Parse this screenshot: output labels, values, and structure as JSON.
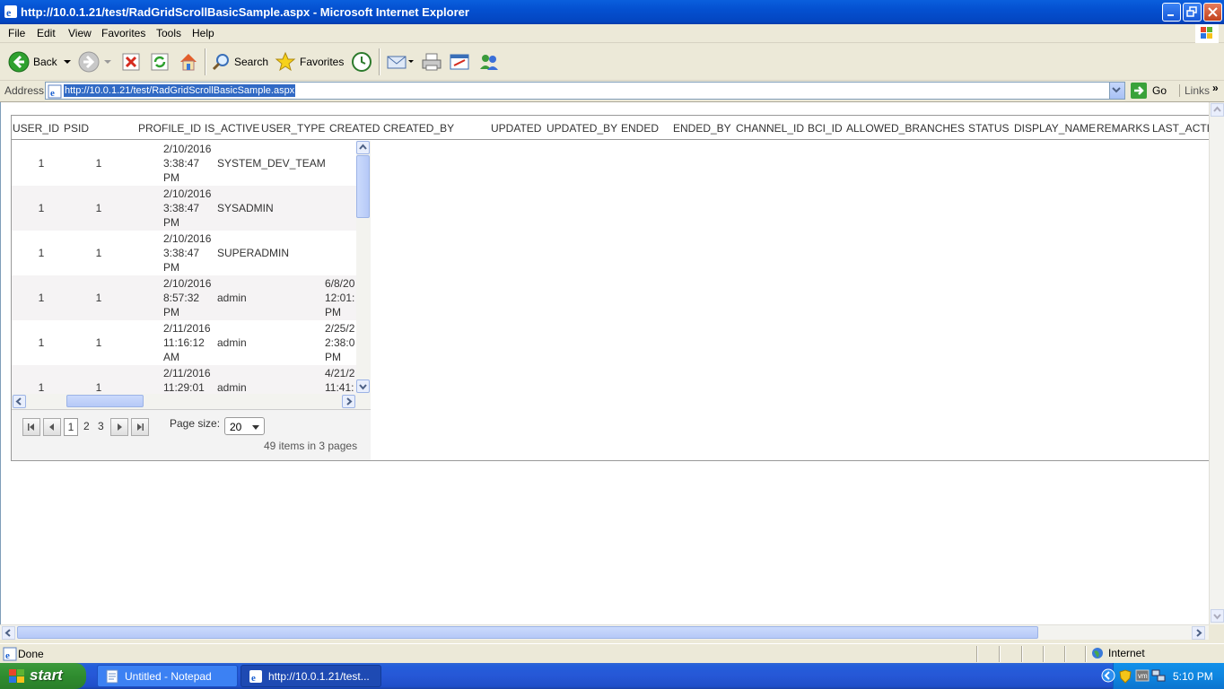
{
  "window": {
    "title": "http://10.0.1.21/test/RadGridScrollBasicSample.aspx - Microsoft Internet Explorer"
  },
  "menu": [
    "File",
    "Edit",
    "View",
    "Favorites",
    "Tools",
    "Help"
  ],
  "toolbar": {
    "back": "Back",
    "search": "Search",
    "favorites": "Favorites"
  },
  "address": {
    "label": "Address",
    "url": "http://10.0.1.21/test/RadGridScrollBasicSample.aspx",
    "go": "Go",
    "links": "Links"
  },
  "grid": {
    "columns": [
      "USER_ID",
      "PSID",
      "PROFILE_ID",
      "IS_ACTIVE",
      "USER_TYPE",
      "CREATED",
      "CREATED_BY",
      "UPDATED",
      "UPDATED_BY",
      "ENDED",
      "ENDED_BY",
      "CHANNEL_ID",
      "BCI_ID",
      "ALLOWED_BRANCHES",
      "STATUS",
      "DISPLAY_NAME",
      "REMARKS",
      "LAST_ACTI"
    ],
    "rows": [
      {
        "user_id": "1",
        "psid": "1",
        "created_date": "2/10/2016",
        "created_time": "3:38:47",
        "created_ampm": "PM",
        "created_by": "SYSTEM_DEV_TEAM",
        "updated_date": "",
        "updated_time": "",
        "updated_ampm": ""
      },
      {
        "user_id": "1",
        "psid": "1",
        "created_date": "2/10/2016",
        "created_time": "3:38:47",
        "created_ampm": "PM",
        "created_by": "SYSADMIN",
        "updated_date": "",
        "updated_time": "",
        "updated_ampm": ""
      },
      {
        "user_id": "1",
        "psid": "1",
        "created_date": "2/10/2016",
        "created_time": "3:38:47",
        "created_ampm": "PM",
        "created_by": "SUPERADMIN",
        "updated_date": "",
        "updated_time": "",
        "updated_ampm": ""
      },
      {
        "user_id": "1",
        "psid": "1",
        "created_date": "2/10/2016",
        "created_time": "8:57:32",
        "created_ampm": "PM",
        "created_by": "admin",
        "updated_date": "6/8/20",
        "updated_time": "12:01:",
        "updated_ampm": "PM"
      },
      {
        "user_id": "1",
        "psid": "1",
        "created_date": "2/11/2016",
        "created_time": "11:16:12",
        "created_ampm": "AM",
        "created_by": "admin",
        "updated_date": "2/25/2",
        "updated_time": "2:38:0",
        "updated_ampm": "PM"
      },
      {
        "user_id": "1",
        "psid": "1",
        "created_date": "2/11/2016",
        "created_time": "11:29:01",
        "created_ampm": "",
        "created_by": "admin",
        "updated_date": "4/21/2",
        "updated_time": "11:41:",
        "updated_ampm": ""
      }
    ]
  },
  "pager": {
    "pages": [
      "1",
      "2",
      "3"
    ],
    "current": "1",
    "page_size_label": "Page size:",
    "page_size": "20",
    "info": "49 items in 3 pages"
  },
  "status": {
    "text": "Done",
    "zone": "Internet"
  },
  "taskbar": {
    "start": "start",
    "tasks": [
      "Untitled - Notepad",
      "http://10.0.1.21/test..."
    ],
    "clock": "5:10 PM"
  }
}
